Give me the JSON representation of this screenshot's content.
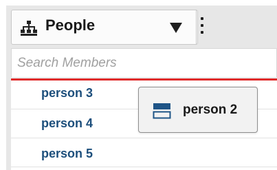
{
  "selector": {
    "label": "People",
    "icon": "people-hierarchy-icon",
    "dropdown_icon": "triangle-down-icon",
    "menu_icon": "kebab-menu-icon"
  },
  "search": {
    "placeholder": "Search Members",
    "value": ""
  },
  "drop_indicator_color": "#e02a2a",
  "members": [
    {
      "label": "person 3"
    },
    {
      "label": "person 4"
    },
    {
      "label": "person 5"
    }
  ],
  "drag_ghost": {
    "label": "person 2",
    "icon": "member-item-icon"
  },
  "colors": {
    "member_text": "#1d4f7c",
    "panel_bg": "#e7e7e7"
  }
}
